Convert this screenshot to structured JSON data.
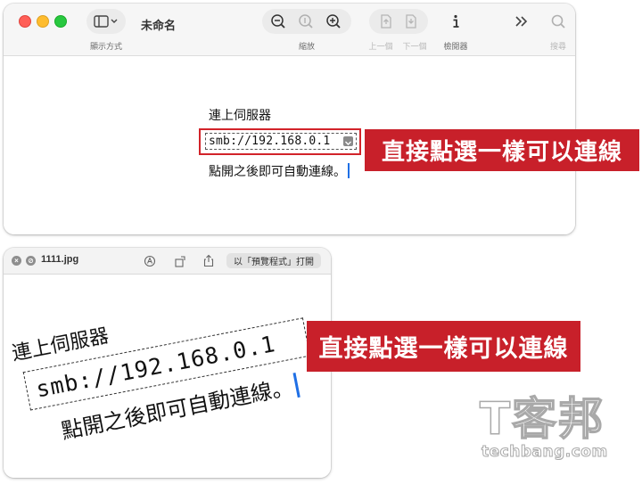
{
  "preview_window": {
    "title": "未命名",
    "toolbar": {
      "sidebar_label": "顯示方式",
      "zoom_label": "縮放",
      "prev_label": "上一個",
      "next_label": "下一個",
      "inspector_label": "檢閱器",
      "search_label": "搜尋"
    },
    "document": {
      "title": "連上伺服器",
      "server_address": "smb://192.168.0.1",
      "body": "點開之後即可自動連線。"
    }
  },
  "banner_text": "直接點選一樣可以連線",
  "quicklook_window": {
    "filename": "1111.jpg",
    "open_with": "以「預覽程式」打開",
    "image": {
      "title": "連上伺服器",
      "server_address": "smb://192.168.0.1",
      "body": "點開之後即可自動連線。"
    }
  },
  "watermark": {
    "brand": "T客邦",
    "url": "techbang.com"
  },
  "colors": {
    "banner_red": "#c8202a",
    "highlight_border": "#d2232a",
    "caret_blue": "#1f6fe5"
  }
}
